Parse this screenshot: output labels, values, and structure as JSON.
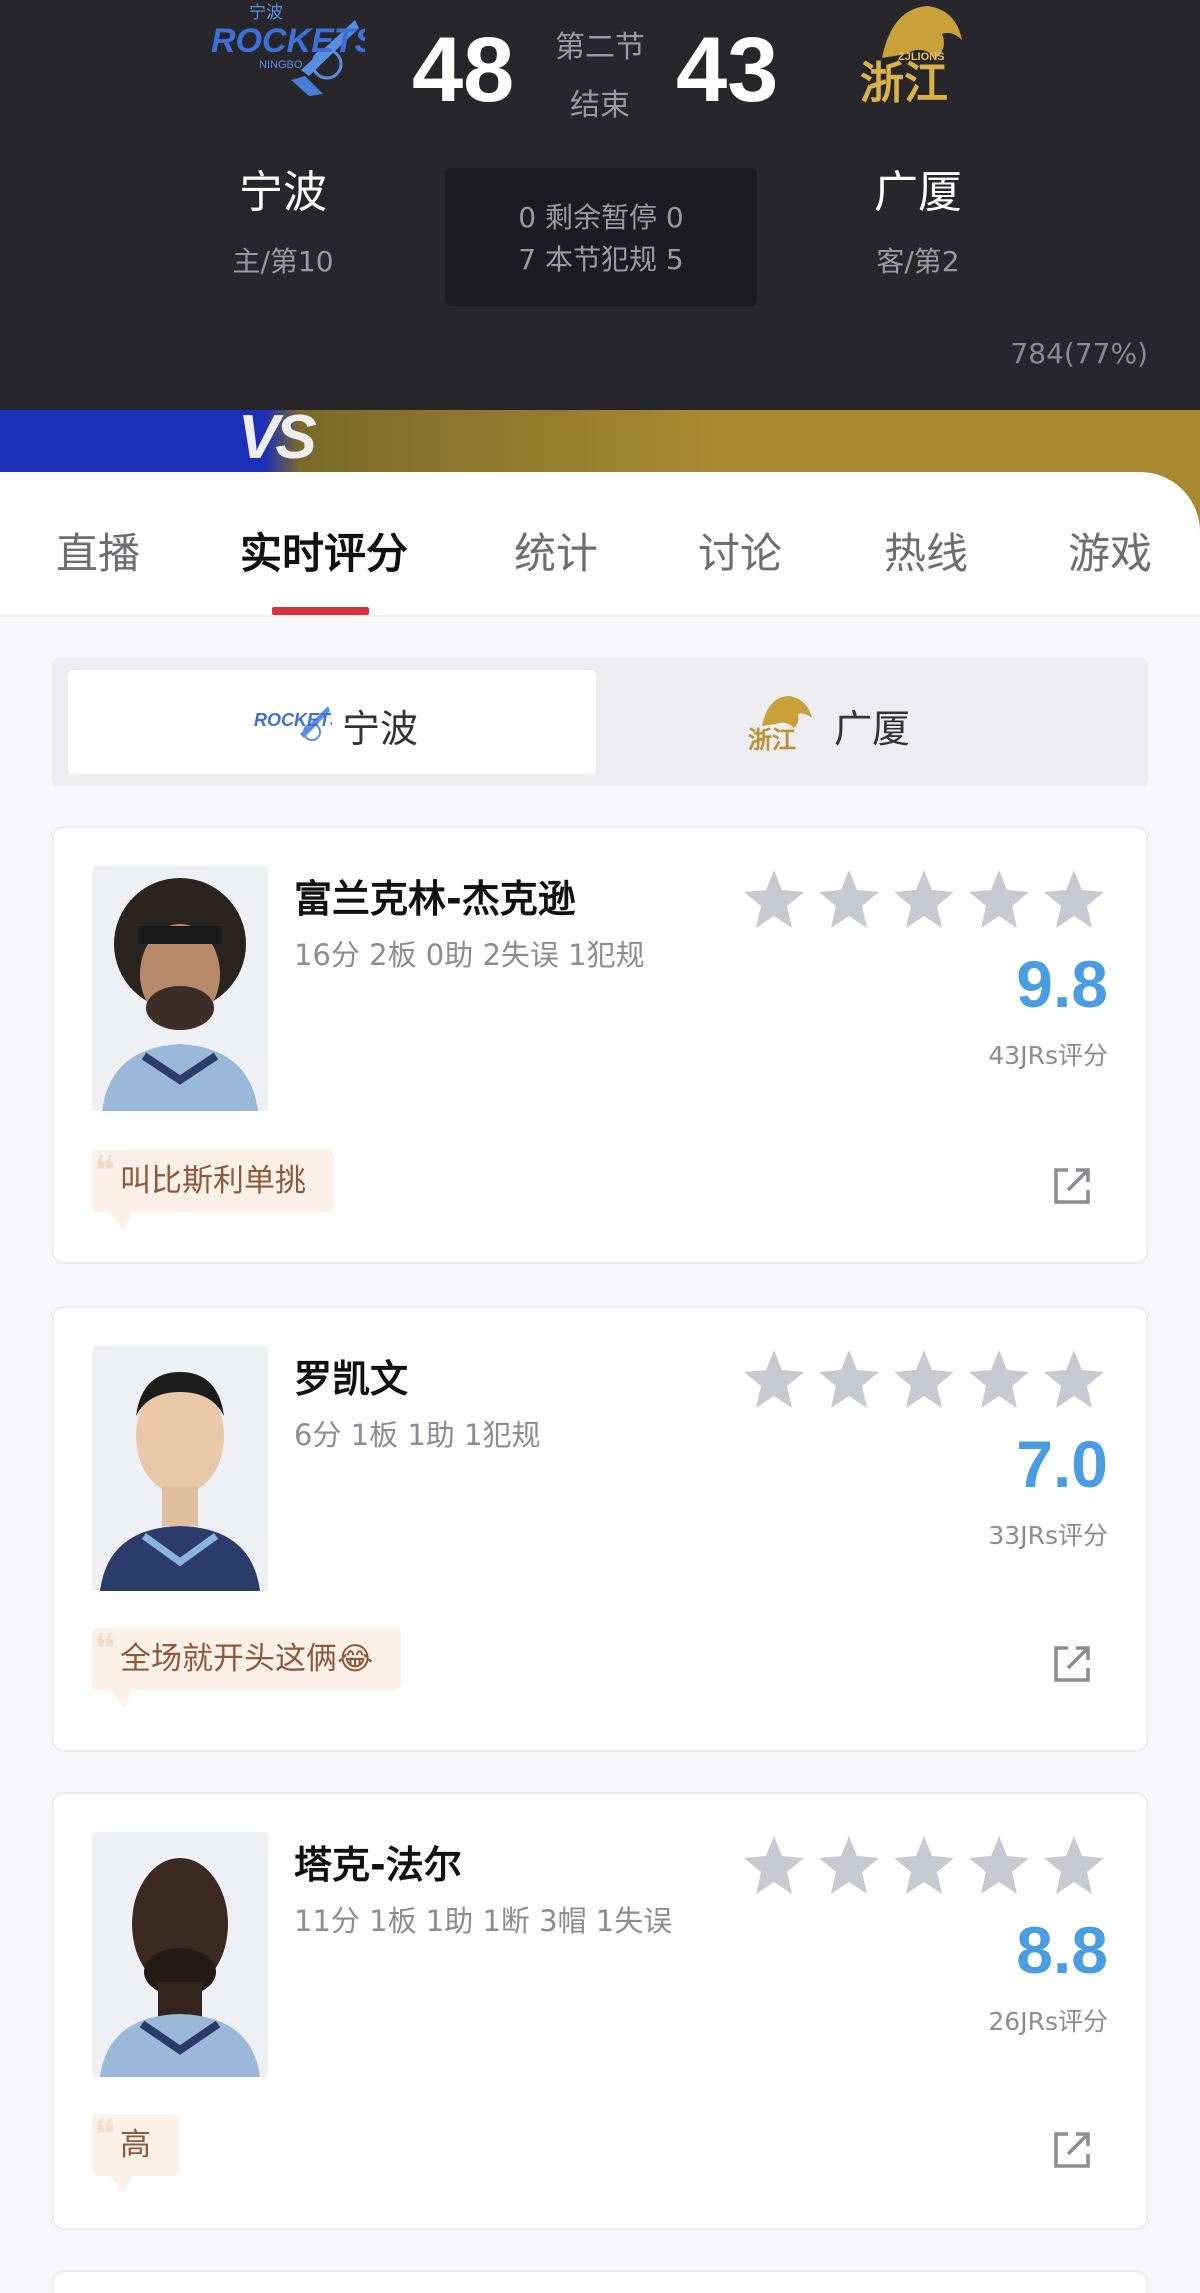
{
  "game": {
    "home": {
      "name": "宁波",
      "sub": "主/第10",
      "score": "48"
    },
    "away": {
      "name": "广厦",
      "sub": "客/第2",
      "score": "43"
    },
    "period": "第二节",
    "status": "结束",
    "timeouts_line": "0 剩余暂停 0",
    "fouls_line": "7 本节犯规 5",
    "popularity": "784(77%)",
    "vs_text": "VS",
    "home_logo_text": "ROCKETS",
    "home_logo_top": "宁波",
    "home_logo_small": "NINGBO",
    "away_logo_text": "浙江",
    "away_logo_small": "ZJLIONS"
  },
  "tabs": [
    "直播",
    "实时评分",
    "统计",
    "讨论",
    "热线",
    "游戏"
  ],
  "active_tab": "实时评分",
  "team_switch": {
    "home_label": "宁波",
    "away_label": "广厦",
    "active": "宁波"
  },
  "players": [
    {
      "name": "富兰克林-杰克逊",
      "stats": "16分 2板 0助 2失误 1犯规",
      "rating": "9.8",
      "rating_count": "43JRs评分",
      "comment": "叫比斯利单挑",
      "stars": 5
    },
    {
      "name": "罗凯文",
      "stats": "6分 1板 1助 1犯规",
      "rating": "7.0",
      "rating_count": "33JRs评分",
      "comment": "全场就开头这俩😂",
      "stars": 5
    },
    {
      "name": "塔克-法尔",
      "stats": "11分 1板 1助 1断 3帽 1失误",
      "rating": "8.8",
      "rating_count": "26JRs评分",
      "comment": "高",
      "stars": 5
    }
  ],
  "colors": {
    "header_bg": "#26262b",
    "accent_red": "#d5323b",
    "rating_blue": "#4a9ee0",
    "star_gray": "#c8c9d1",
    "comment_bg": "#fcf1e9",
    "comment_text": "#8e5a3a"
  }
}
